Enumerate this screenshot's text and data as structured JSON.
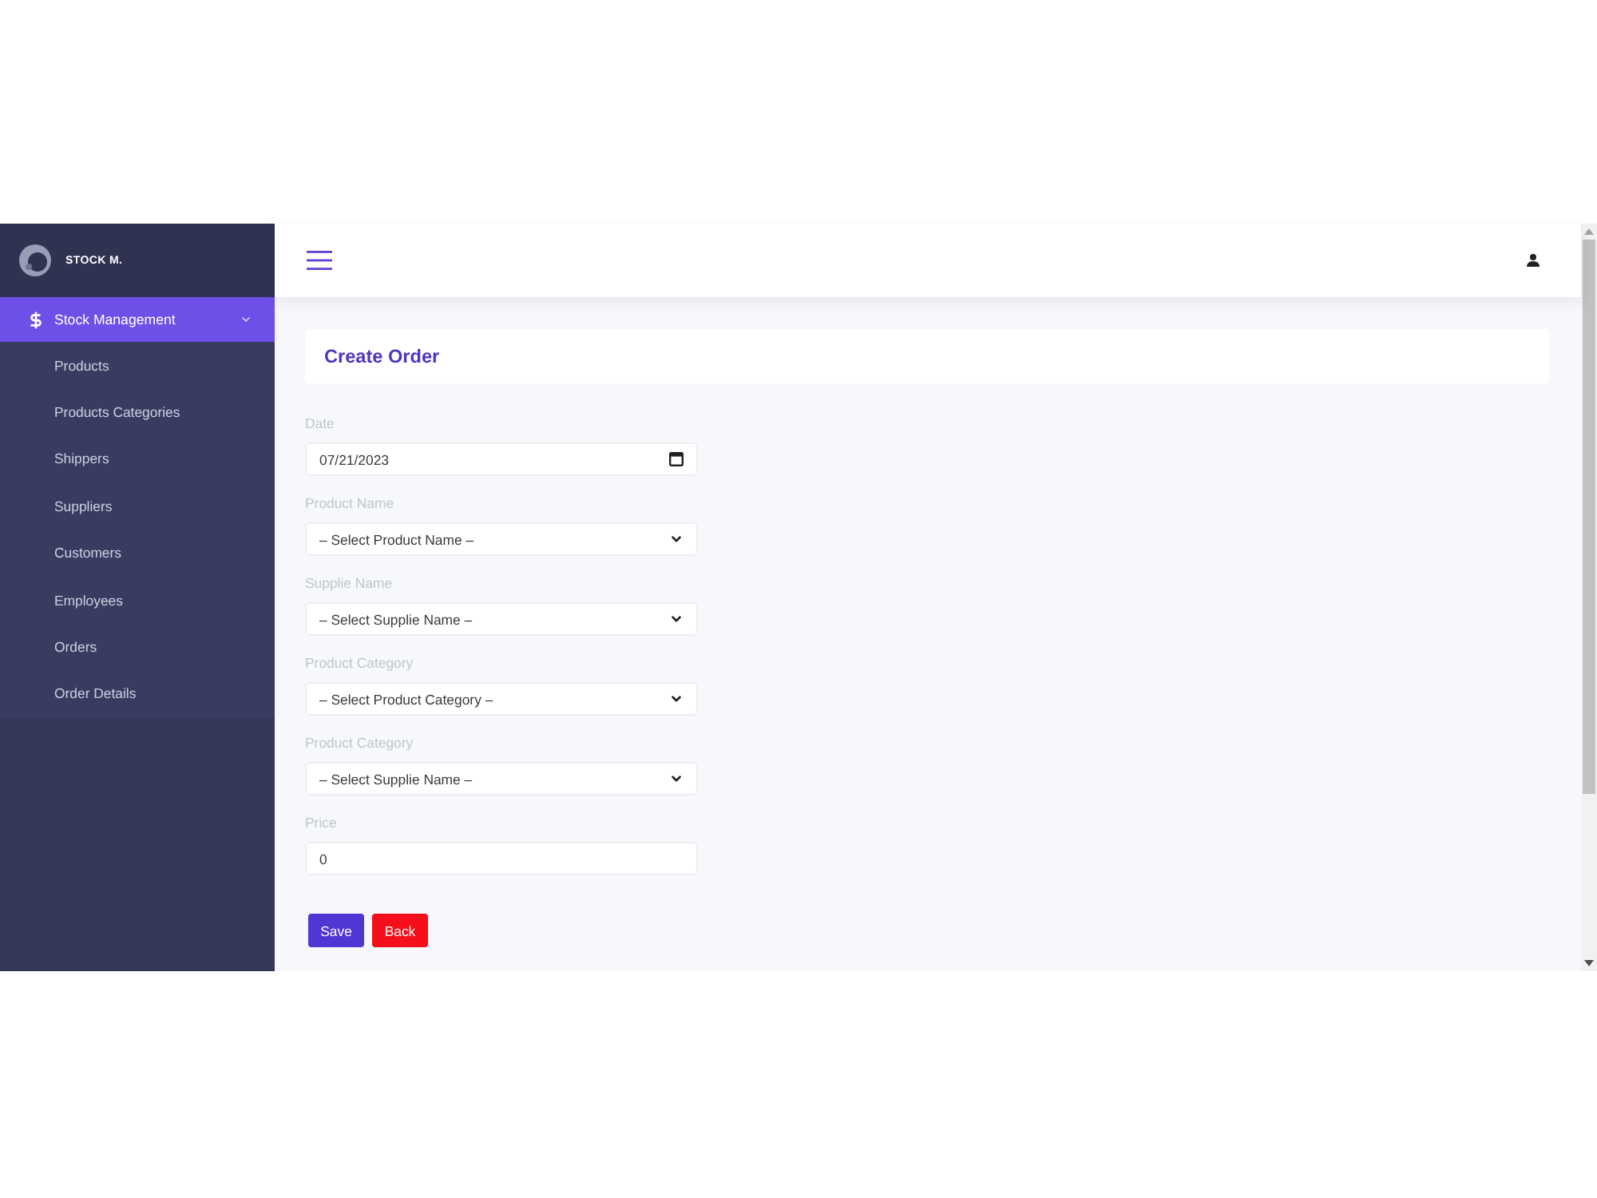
{
  "sidebar": {
    "brand": "STOCK M.",
    "menu": [
      {
        "label": "Stock Management",
        "selected": true,
        "expanded": true,
        "children": [
          {
            "label": "Products",
            "selected": false
          },
          {
            "label": "Products Categories",
            "selected": false
          },
          {
            "label": "Shippers",
            "selected": false
          },
          {
            "label": "Suppliers",
            "selected": false
          },
          {
            "label": "Customers",
            "selected": false
          },
          {
            "label": "Employees",
            "selected": false
          },
          {
            "label": "Orders",
            "selected": false
          },
          {
            "label": "Order Details",
            "selected": false
          }
        ]
      }
    ]
  },
  "page": {
    "title": "Create Order"
  },
  "form": {
    "fields": [
      {
        "kind": "date",
        "label": "Date",
        "value": "07/21/2023"
      },
      {
        "kind": "select",
        "label": "Product Name",
        "value": "– Select Product Name –"
      },
      {
        "kind": "select",
        "label": "Supplie Name",
        "value": "– Select Supplie Name –"
      },
      {
        "kind": "select",
        "label": "Product Category",
        "value": "– Select Product Category –"
      },
      {
        "kind": "select",
        "label": "Product Category",
        "value": "– Select Supplie Name –"
      },
      {
        "kind": "text",
        "label": "Price",
        "value": "0"
      }
    ],
    "buttons": [
      {
        "kind": "primary",
        "label": "Save"
      },
      {
        "kind": "danger",
        "label": "Back"
      }
    ]
  }
}
